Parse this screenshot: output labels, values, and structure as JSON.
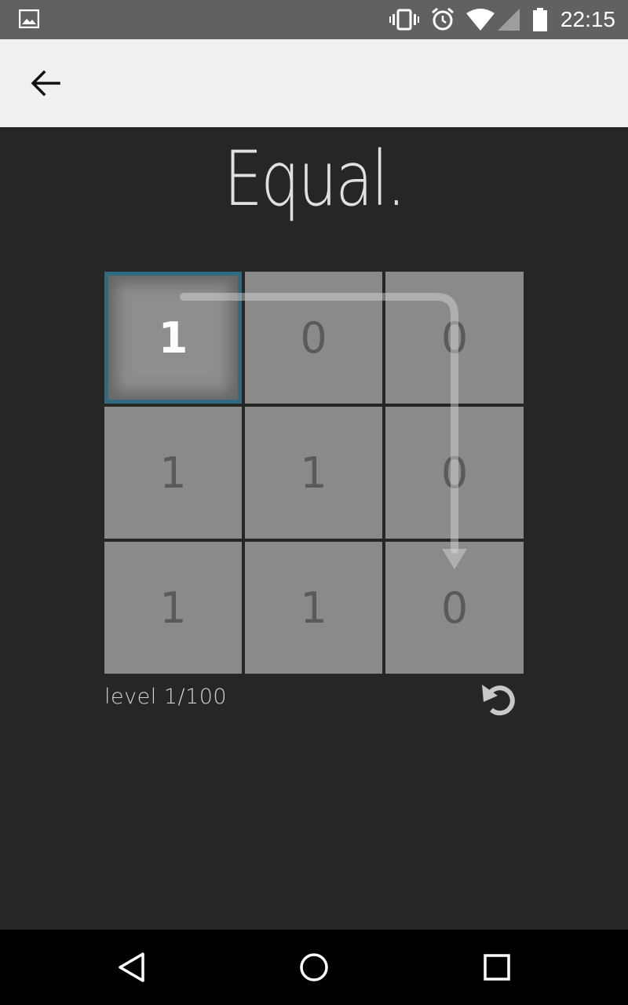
{
  "status_bar": {
    "time": "22:15",
    "icons": [
      "image-icon",
      "vibrate-icon",
      "alarm-icon",
      "wifi-icon",
      "signal-icon",
      "battery-icon"
    ]
  },
  "app_bar": {
    "back_icon": "arrow-back-icon"
  },
  "game": {
    "title": "Equal.",
    "grid": [
      [
        "1",
        "0",
        "0"
      ],
      [
        "1",
        "1",
        "0"
      ],
      [
        "1",
        "1",
        "0"
      ]
    ],
    "selected_cell": "row 1, column 1",
    "level_label": "level 1/100",
    "reset_icon": "undo-icon"
  },
  "nav_bar": {
    "icons": [
      "back-triangle-icon",
      "home-circle-icon",
      "recents-square-icon"
    ]
  },
  "colors": {
    "background": "#262626",
    "cell": "#8a8a8a",
    "cell_text": "#5a5a5a",
    "selected_border": "#2e6b80",
    "status_bar": "#616161",
    "app_bar": "#f0f0f0"
  }
}
